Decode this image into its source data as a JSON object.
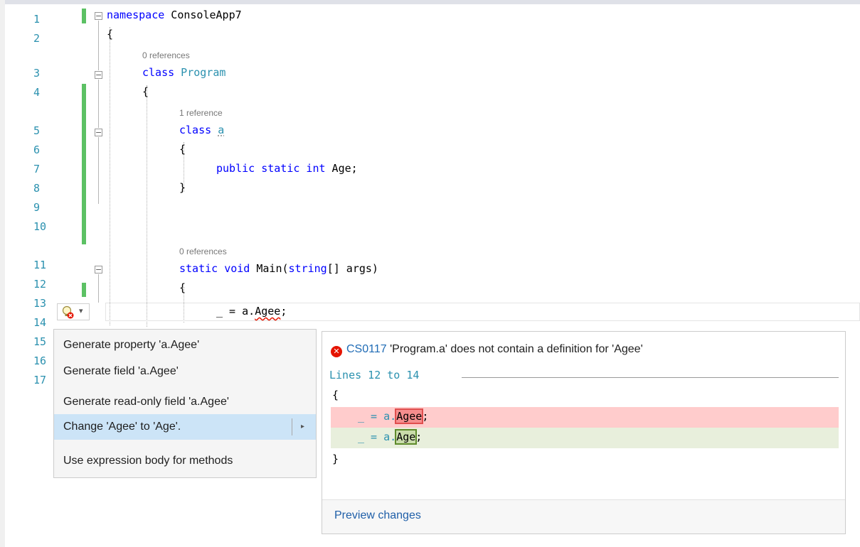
{
  "editor": {
    "line_numbers": [
      "1",
      "2",
      "3",
      "4",
      "5",
      "6",
      "7",
      "8",
      "9",
      "10",
      "11",
      "12",
      "13",
      "14",
      "15",
      "16",
      "17"
    ],
    "code": {
      "l1_kw": "namespace",
      "l1_name": " ConsoleApp7",
      "l2": "{",
      "ref_program": "0 references",
      "l3_kw": "class",
      "l3_name": " Program",
      "l4": "{",
      "ref_a": "1 reference",
      "l5_kw": "class",
      "l5_name": "a",
      "l6": "{",
      "l7_kw": "public static int",
      "l7_rest": " Age;",
      "l8": "}",
      "ref_main": "0 references",
      "l11_kw": "static void",
      "l11_name": " Main(",
      "l11_type": "string",
      "l11_rest": "[] args)",
      "l12": "{",
      "l13_pre": "_ = a.",
      "l13_err": "Agee",
      "l13_post": ";"
    }
  },
  "lightbulb": {
    "icon": "lightbulb-error-icon",
    "dropdown": "▾"
  },
  "quick_actions": {
    "items": [
      "Generate property 'a.Agee'",
      "Generate field 'a.Agee'",
      "Generate read-only field 'a.Agee'",
      "Change 'Agee' to 'Age'.",
      "Use expression body for methods"
    ],
    "selected_index": 3,
    "submenu_arrow": "▸"
  },
  "preview": {
    "error_code": "CS0117",
    "error_message": " 'Program.a' does not contain a definition for 'Agee'",
    "lines_label": "Lines 12 to 14",
    "open_brace": "{",
    "removed_pre": "_ = a.",
    "removed_word": "Agee",
    "removed_post": ";",
    "added_pre": "_ = a.",
    "added_word": "Age",
    "added_post": ";",
    "close_brace": "}",
    "preview_link": "Preview changes"
  },
  "colors": {
    "keyword": "#0000ff",
    "type": "#2b91af",
    "change_bar": "#5cc164",
    "error": "#e51400",
    "selection": "#cce4f7"
  }
}
